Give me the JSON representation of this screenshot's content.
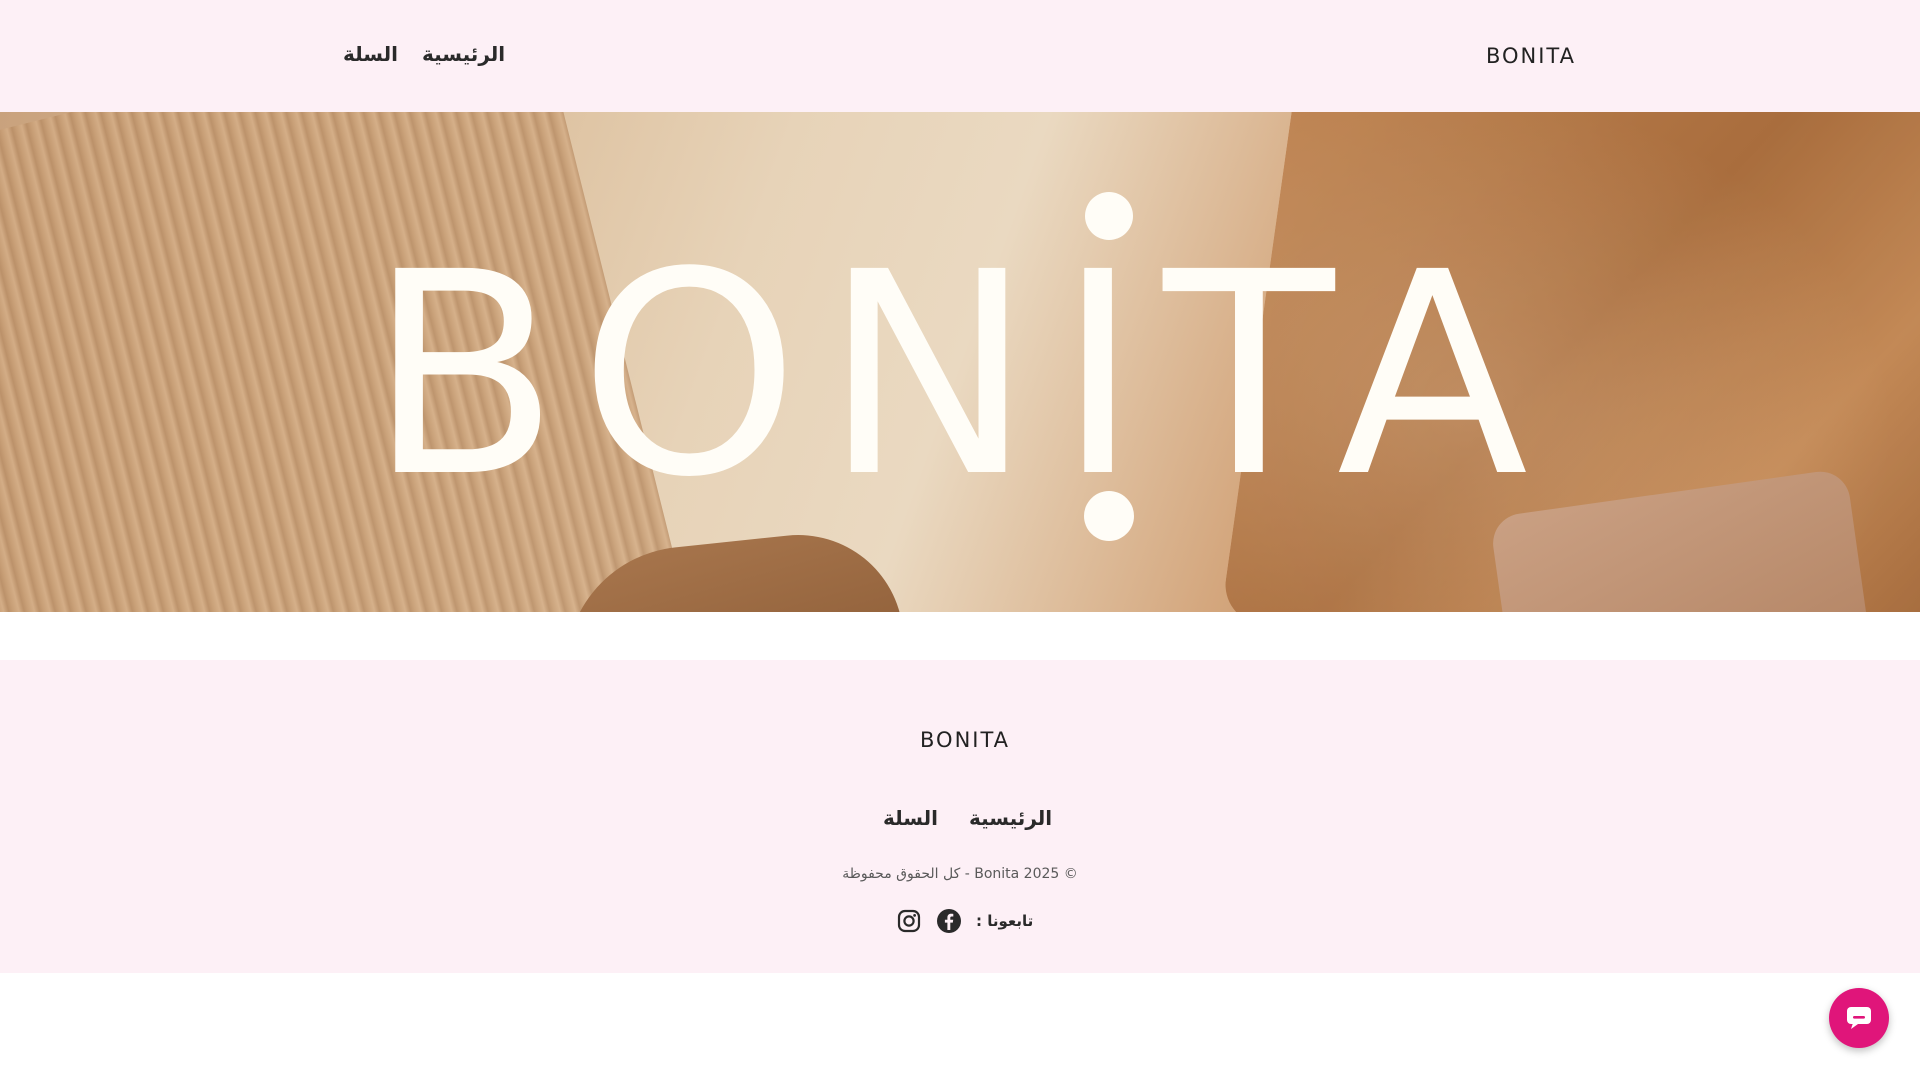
{
  "header": {
    "logo": "BONITA",
    "nav": [
      {
        "label": "الرئيسية"
      },
      {
        "label": "السلة"
      }
    ]
  },
  "hero": {
    "logo_text": "BONITA"
  },
  "footer": {
    "logo": "BONITA",
    "nav": [
      {
        "label": "الرئيسية"
      },
      {
        "label": "السلة"
      }
    ],
    "copyright": "© Bonita 2025 - كل الحقوق محفوظة",
    "follow_label": "تابعونا :",
    "social_icons": [
      "facebook-icon",
      "instagram-icon"
    ]
  },
  "chat": {
    "icon": "chat-bubble-icon",
    "color": "#e0157a"
  },
  "colors": {
    "header_bg": "#fdf0f6",
    "footer_bg": "#fdf0f6",
    "text": "#2a2a2a"
  }
}
